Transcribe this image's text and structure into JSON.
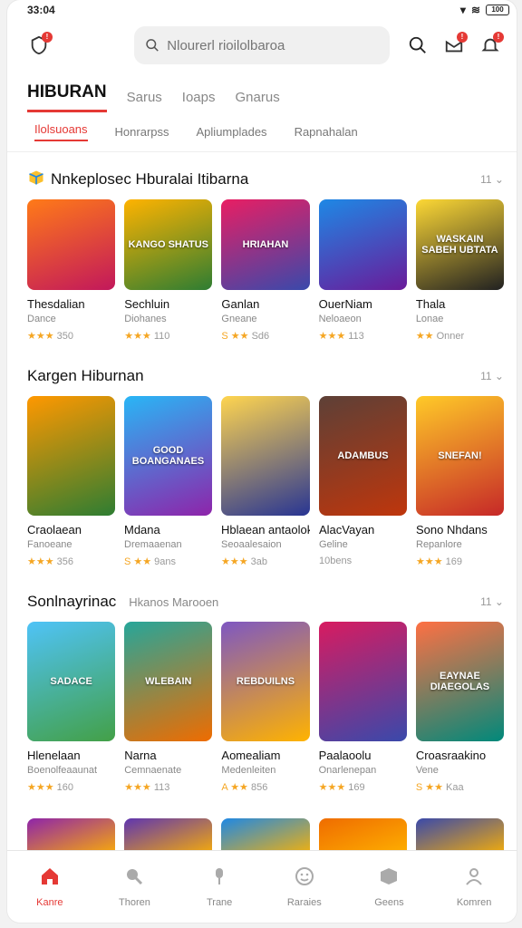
{
  "status": {
    "time": "33:04",
    "battery": "100"
  },
  "search": {
    "placeholder": "Nlourerl rioilolbaroa"
  },
  "tabs": [
    "HIBURAN",
    "Sarus",
    "Ioaps",
    "Gnarus"
  ],
  "subtabs": [
    "Ilolsuoans",
    "Honrarpss",
    "Apliumplades",
    "Rapnahalan"
  ],
  "sections": [
    {
      "title": "Nnkeplosec Hburalai Itibarna",
      "subtitle": "",
      "more": "11",
      "cards": [
        {
          "name": "Thesdalian",
          "genre": "Dance",
          "stars": "★★★",
          "rating": "350",
          "thumb_text": "",
          "colors": [
            "#ff7a18",
            "#c2185b"
          ]
        },
        {
          "name": "Sechluin",
          "genre": "Diohanes",
          "stars": "★★★",
          "rating": "110",
          "thumb_text": "KANGO SHATUS",
          "colors": [
            "#ffb300",
            "#2e7d32"
          ]
        },
        {
          "name": "Ganlan",
          "genre": "Gneane",
          "stars": "S ★★",
          "rating": "Sd6",
          "thumb_text": "HRIAHAN",
          "colors": [
            "#e91e63",
            "#3949ab"
          ]
        },
        {
          "name": "OuerNiam",
          "genre": "Neloaeon",
          "stars": "★★★",
          "rating": "113",
          "thumb_text": "",
          "colors": [
            "#1e88e5",
            "#6a1b9a"
          ]
        },
        {
          "name": "Thala",
          "genre": "Lonae",
          "stars": "★★",
          "rating": "Onner",
          "thumb_text": "WASKAIN SABEH UBTATA",
          "colors": [
            "#fdd835",
            "#212121"
          ]
        }
      ]
    },
    {
      "title": "Kargen Hiburnan",
      "subtitle": "",
      "more": "11",
      "cards": [
        {
          "name": "Craolaean",
          "genre": "Fanoeane",
          "stars": "★★★",
          "rating": "356",
          "thumb_text": "",
          "colors": [
            "#ff9800",
            "#2e7d32"
          ]
        },
        {
          "name": "Mdana",
          "genre": "Dremaaenan",
          "stars": "S ★★",
          "rating": "9ans",
          "thumb_text": "GOOD BOANGANAES",
          "colors": [
            "#29b6f6",
            "#8e24aa"
          ]
        },
        {
          "name": "Hblaean antaolokta",
          "genre": "Seoaalesaion",
          "stars": "★★★",
          "rating": "3ab",
          "thumb_text": "",
          "colors": [
            "#ffd54f",
            "#283593"
          ]
        },
        {
          "name": "AlacVayan",
          "genre": "Geline",
          "stars": "",
          "rating": "10bens",
          "thumb_text": "ADAMBUS",
          "colors": [
            "#5d4037",
            "#bf360c"
          ]
        },
        {
          "name": "Sono Nhdans",
          "genre": "Repanlore",
          "stars": "★★★",
          "rating": "169",
          "thumb_text": "SNEFAN!",
          "colors": [
            "#ffca28",
            "#c62828"
          ]
        }
      ]
    },
    {
      "title": "Sonlnayrinac",
      "subtitle": "Hkanos Marooen",
      "more": "11",
      "cards": [
        {
          "name": "Hlenelaan",
          "genre": "Boenolfeaaunat",
          "stars": "★★★",
          "rating": "160",
          "thumb_text": "SADACE",
          "colors": [
            "#4fc3f7",
            "#43a047"
          ]
        },
        {
          "name": "Narna",
          "genre": "Cemnaenate",
          "stars": "★★★",
          "rating": "113",
          "thumb_text": "WLEBAIN",
          "colors": [
            "#26a69a",
            "#ef6c00"
          ]
        },
        {
          "name": "Aomealiam",
          "genre": "Medenleiten",
          "stars": "A ★★",
          "rating": "856",
          "thumb_text": "REBDUILNS",
          "colors": [
            "#7e57c2",
            "#ffb300"
          ]
        },
        {
          "name": "Paalaoolu",
          "genre": "Onarlenepan",
          "stars": "★★★",
          "rating": "169",
          "thumb_text": "",
          "colors": [
            "#d81b60",
            "#3949ab"
          ]
        },
        {
          "name": "Croasraakino",
          "genre": "Vene",
          "stars": "S ★★",
          "rating": "Kaa",
          "thumb_text": "EAYNAE DIAEGOLAS",
          "colors": [
            "#ff7043",
            "#00897b"
          ]
        }
      ]
    }
  ],
  "partial_colors": [
    "#8e24aa",
    "#5e35b1",
    "#1e88e5",
    "#ef6c00",
    "#3949ab"
  ],
  "nav": [
    {
      "label": "Kanre",
      "icon": "home-icon",
      "active": true
    },
    {
      "label": "Thoren",
      "icon": "search-icon",
      "active": false
    },
    {
      "label": "Trane",
      "icon": "mic-icon",
      "active": false
    },
    {
      "label": "Raraies",
      "icon": "emoji-icon",
      "active": false
    },
    {
      "label": "Geens",
      "icon": "box-icon",
      "active": false
    },
    {
      "label": "Komren",
      "icon": "user-icon",
      "active": false
    }
  ],
  "accent": "#e53935"
}
